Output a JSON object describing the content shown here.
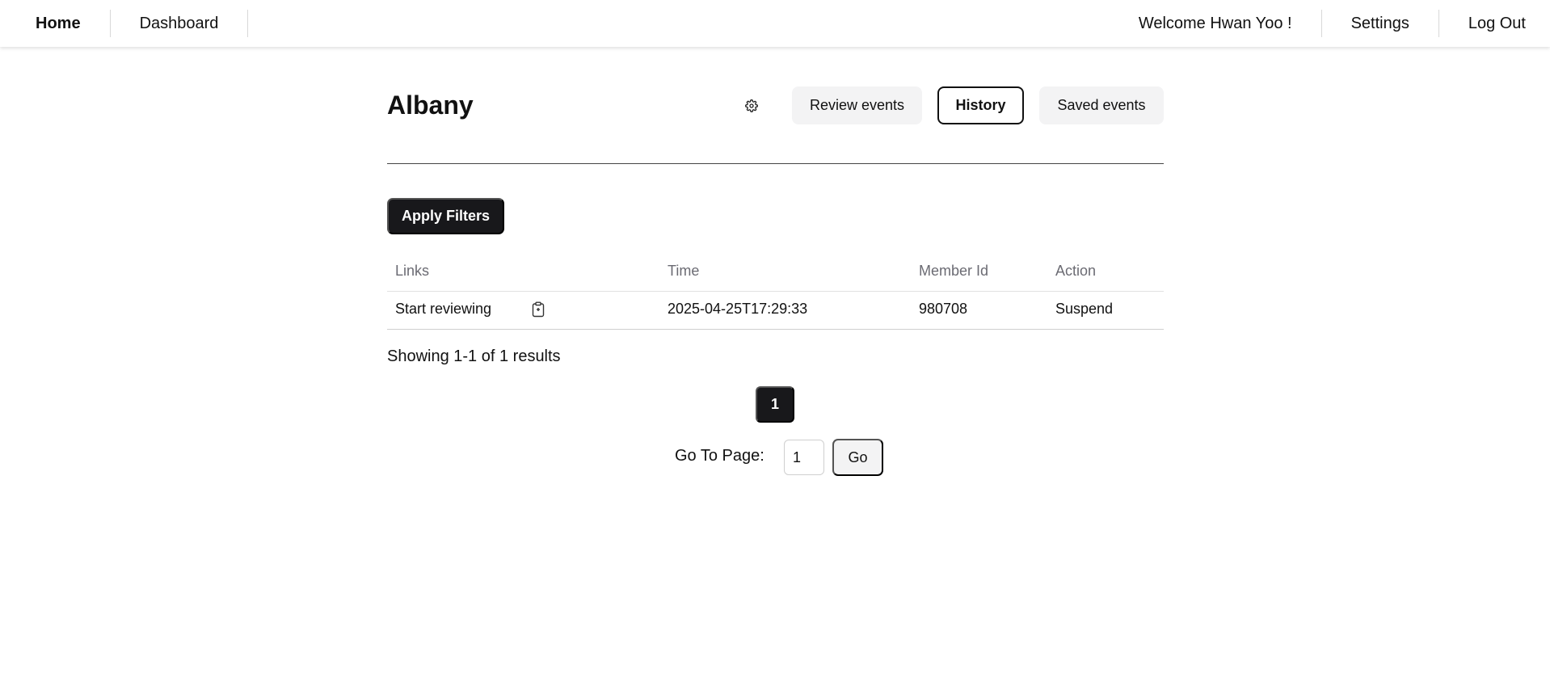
{
  "nav": {
    "home": "Home",
    "dashboard": "Dashboard",
    "welcome": "Welcome Hwan Yoo !",
    "settings": "Settings",
    "logout": "Log Out"
  },
  "header": {
    "title": "Albany",
    "gear_icon": "gear-icon",
    "tabs": {
      "review": "Review events",
      "history": "History",
      "saved": "Saved events"
    },
    "active_tab": "History"
  },
  "filters": {
    "apply_label": "Apply Filters"
  },
  "table": {
    "columns": [
      "Links",
      "Time",
      "Member Id",
      "Action"
    ],
    "rows": [
      {
        "link": "Start reviewing",
        "copy_icon": "clipboard-icon",
        "time": "2025-04-25T17:29:33",
        "member_id": "980708",
        "action": "Suspend"
      }
    ]
  },
  "pagination": {
    "summary": "Showing 1-1 of 1 results",
    "current_page": "1",
    "goto_label": "Go To Page:",
    "goto_value": "1",
    "go_label": "Go"
  },
  "colors": {
    "primary_dark": "#18181b",
    "tab_bg": "#f3f3f4",
    "header_text_muted": "#6b6b73"
  }
}
